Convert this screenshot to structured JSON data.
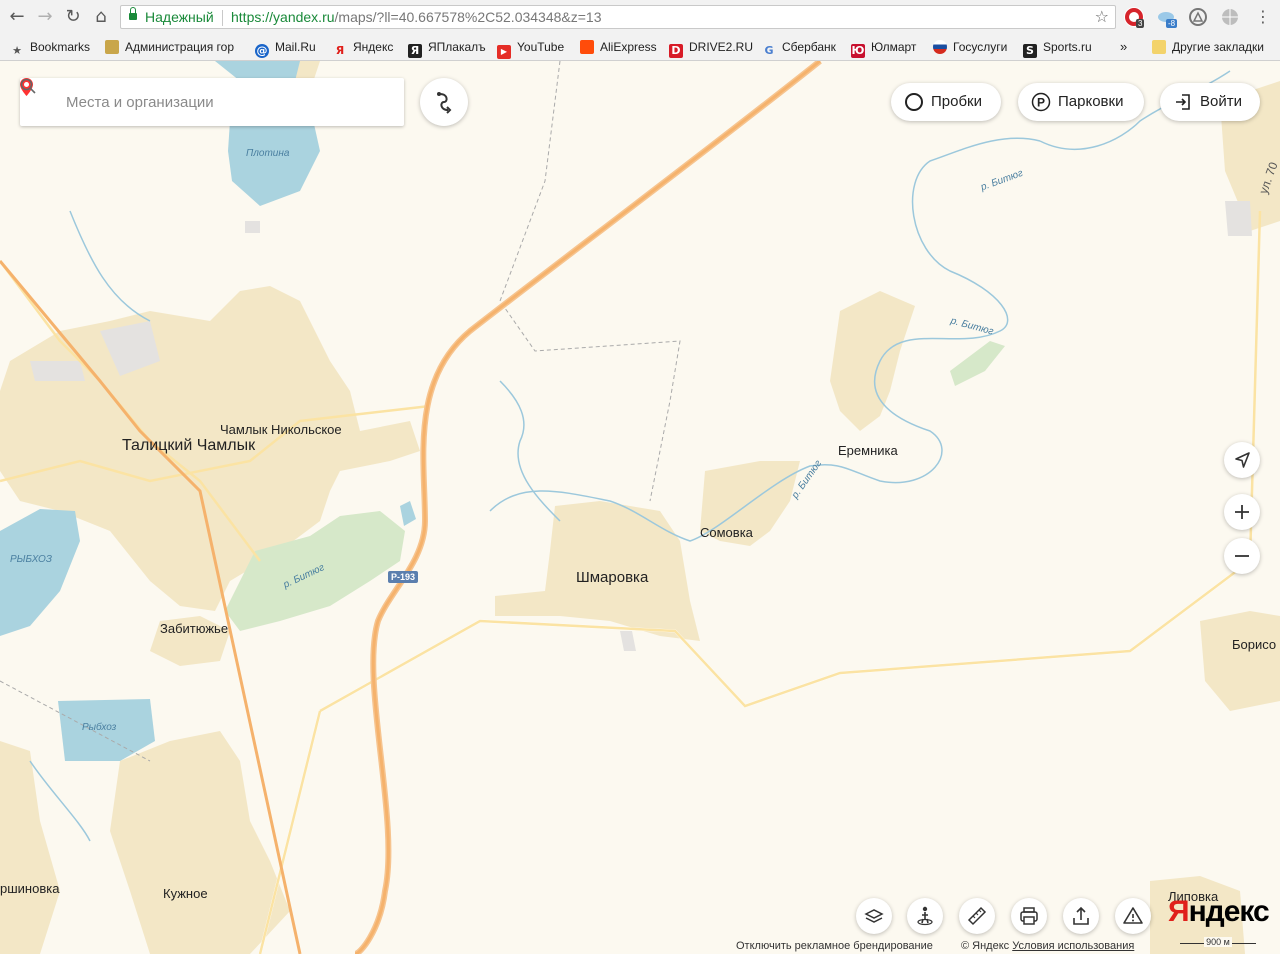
{
  "browser": {
    "secure_label": "Надежный",
    "url_scheme": "https://",
    "url_host": "yandex.ru",
    "url_path": "/maps/?ll=40.667578%2C52.034348&z=13",
    "ext_badge_1": "3",
    "ext_badge_2": "-8"
  },
  "bookmarks": [
    {
      "label": "Bookmarks",
      "icon": "star-icon",
      "color": "#555555"
    },
    {
      "label": "Администрация гор",
      "icon": "coat-of-arms-icon",
      "color": "#c9a64a"
    },
    {
      "label": "Mail.Ru",
      "icon": "mailru-icon",
      "color": "#1a65c9"
    },
    {
      "label": "Яндекс",
      "icon": "yandex-icon",
      "color": "#e0201b"
    },
    {
      "label": "ЯПлакалъ",
      "icon": "yaplakal-icon",
      "color": "#222222"
    },
    {
      "label": "YouTube",
      "icon": "youtube-icon",
      "color": "#e52d27"
    },
    {
      "label": "AliExpress",
      "icon": "aliexpress-icon",
      "color": "#ff4c0a"
    },
    {
      "label": "DRIVE2.RU",
      "icon": "drive2-icon",
      "color": "#d81b27"
    },
    {
      "label": "Сбербанк",
      "icon": "google-icon",
      "color": "#4a7fd0"
    },
    {
      "label": "Юлмарт",
      "icon": "ulmart-icon",
      "color": "#c8102e"
    },
    {
      "label": "Госуслуги",
      "icon": "russia-flag-icon",
      "color": "#1c4fa1"
    },
    {
      "label": "Sports.ru",
      "icon": "sports-icon",
      "color": "#222222"
    },
    {
      "label": "»",
      "icon": "more-icon",
      "color": "#555555"
    },
    {
      "label": "Другие закладки",
      "icon": "folder-icon",
      "color": "#f3d36b"
    }
  ],
  "map_ui": {
    "search_placeholder": "Места и организации",
    "traffic_label": "Пробки",
    "parking_label": "Парковки",
    "parking_letter": "P",
    "login_label": "Войти",
    "disable_branding": "Отключить рекламное брендирование",
    "copyright": "© Яндекс",
    "terms": "Условия использования",
    "logo_first": "Я",
    "logo_rest": "ндекс",
    "scale": "900 м",
    "accent": "#e0201b"
  },
  "places": [
    {
      "name": "Талицкий Чамлык",
      "size": "big"
    },
    {
      "name": "Чамлык Никольское",
      "size": "mid"
    },
    {
      "name": "Еремника",
      "size": "mid"
    },
    {
      "name": "Сомовка",
      "size": "mid"
    },
    {
      "name": "Шмаровка",
      "size": "big"
    },
    {
      "name": "Забитюжье",
      "size": "mid"
    },
    {
      "name": "Кужное",
      "size": "mid"
    },
    {
      "name": "ршиновка",
      "size": "mid"
    },
    {
      "name": "Липовка",
      "size": "mid"
    },
    {
      "name": "Борисо",
      "size": "mid"
    }
  ],
  "water_labels": [
    "Плотина",
    "РЫБХОЗ",
    "Рыбхоз"
  ],
  "river_labels": [
    "р. Битюг",
    "р. Битюг",
    "р. Битюг",
    "р. Битюг"
  ],
  "road_labels": [
    "Р-193",
    "ул. 70"
  ]
}
